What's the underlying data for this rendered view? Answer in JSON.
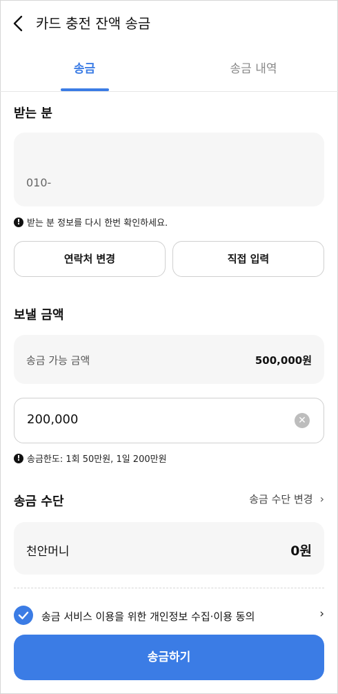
{
  "header": {
    "title": "카드 충전 잔액 송금",
    "back_icon": "chevron-left-icon"
  },
  "tabs": [
    {
      "label": "송금",
      "active": true
    },
    {
      "label": "송금 내역",
      "active": false
    }
  ],
  "recipient": {
    "section_label": "받는 분",
    "phone_placeholder": "010-",
    "notice": "받는 분 정보를 다시 한번 확인하세요.",
    "contact_change_label": "연락처 변경",
    "direct_input_label": "직접 입력"
  },
  "amount": {
    "section_label": "보낼 금액",
    "available_label": "송금 가능 금액",
    "available_value": "500,000원",
    "input_value": "200,000",
    "limit_notice": "송금한도: 1회 50만원, 1일 200만원"
  },
  "method": {
    "section_label": "송금 수단",
    "change_label": "송금 수단 변경",
    "name": "천안머니",
    "balance": "0원"
  },
  "agreement": {
    "label": "송금 서비스 이용을 위한 개인정보 수집·이용 동의",
    "checked": true
  },
  "submit_label": "송금하기",
  "colors": {
    "accent": "#3b7ce5",
    "box_bg": "#f6f6f6"
  }
}
